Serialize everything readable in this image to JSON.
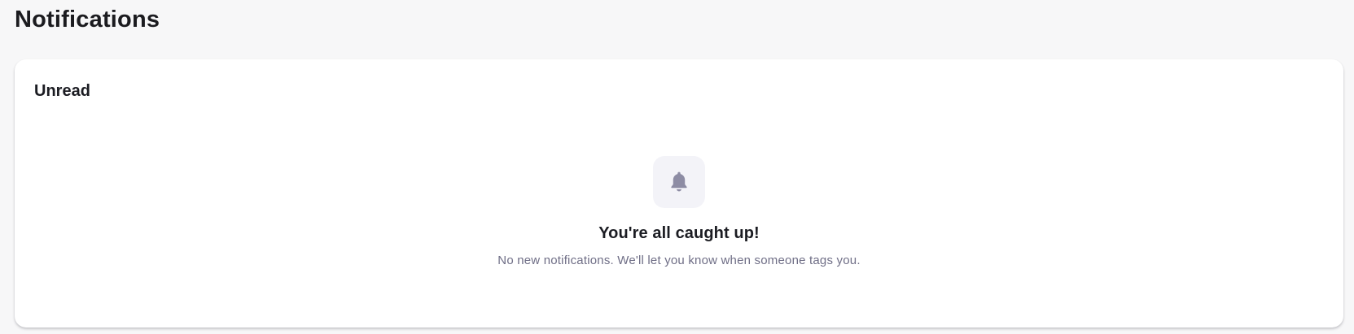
{
  "page": {
    "title": "Notifications"
  },
  "unread_section": {
    "title": "Unread",
    "empty_state": {
      "icon": "bell-icon",
      "title": "You're all caught up!",
      "description": "No new notifications. We'll let you know when someone tags you."
    }
  },
  "colors": {
    "background": "#f7f7f8",
    "card": "#ffffff",
    "icon": "#8d8ca4",
    "icon_bg": "#f3f3f8",
    "muted_text": "#6f6e86"
  }
}
